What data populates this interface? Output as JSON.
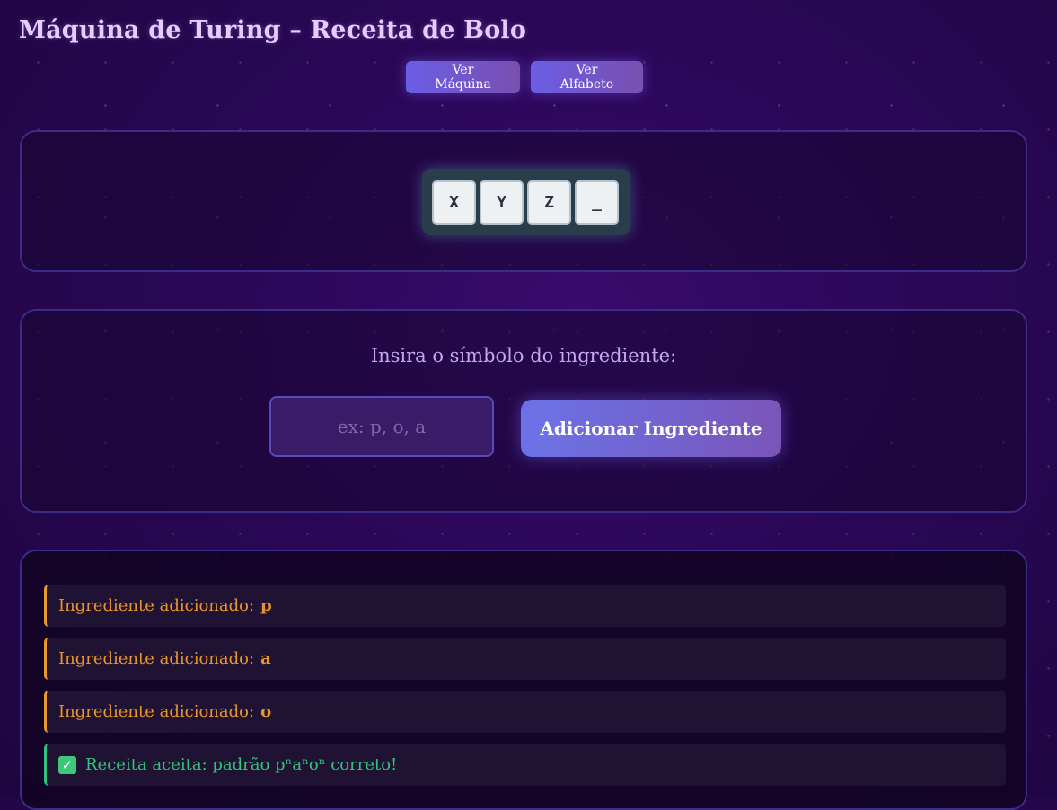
{
  "header": {
    "title": "Máquina de Turing – Receita de Bolo",
    "buttons": [
      "Ver Máquina",
      "Ver Alfabeto"
    ]
  },
  "tape": {
    "cells": [
      "X",
      "Y",
      "Z",
      "_"
    ]
  },
  "input": {
    "prompt": "Insira o símbolo do ingrediente:",
    "placeholder": "ex: p, o, a",
    "value": "",
    "add_button": "Adicionar Ingrediente"
  },
  "log": {
    "items": [
      {
        "text": "Ingrediente adicionado:",
        "symbol": "p"
      },
      {
        "text": "Ingrediente adicionado:",
        "symbol": "a"
      },
      {
        "text": "Ingrediente adicionado:",
        "symbol": "o"
      }
    ],
    "result_icon": "check-icon",
    "result": "Receita aceita: padrão pⁿaⁿoⁿ correto!"
  },
  "colors": {
    "accent": "#6b73e8",
    "warning": "#e8962c",
    "success": "#32c47c",
    "background": "#2a0756"
  }
}
